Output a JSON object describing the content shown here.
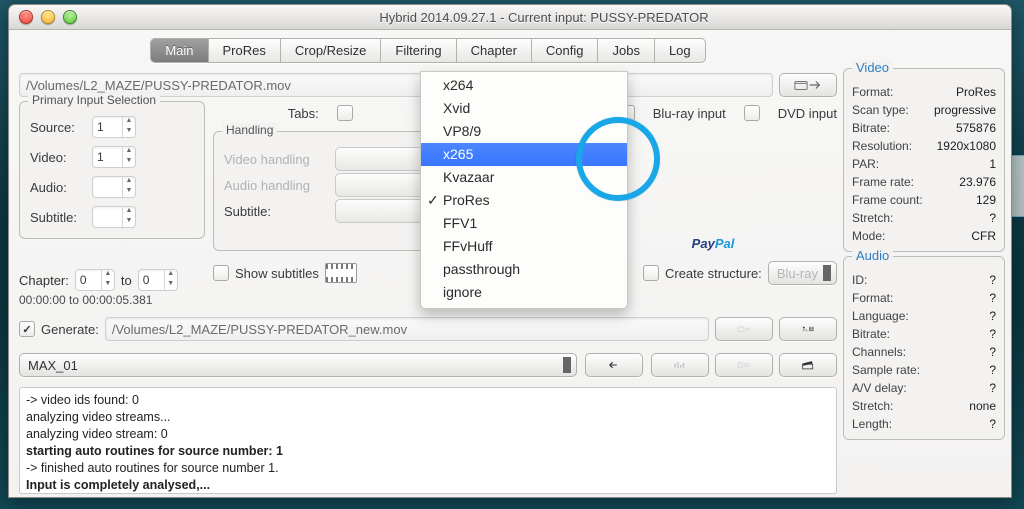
{
  "window_title": "Hybrid 2014.09.27.1 - Current input: PUSSY-PREDATOR",
  "tabs": [
    "Main",
    "ProRes",
    "Crop/Resize",
    "Filtering",
    "Chapter",
    "Config",
    "Jobs",
    "Log"
  ],
  "tabs_selected": 0,
  "source_path": "/Volumes/L2_MAZE/PUSSY-PREDATOR.mov",
  "primary": {
    "legend": "Primary Input Selection",
    "source_label": "Source:",
    "source_value": "1",
    "video_label": "Video:",
    "video_value": "1",
    "audio_label": "Audio:",
    "subtitle_label": "Subtitle:"
  },
  "tabs_line": {
    "tabs_label": "Tabs:",
    "bluray_label": "Blu-ray input",
    "dvd_label": "DVD input"
  },
  "paypal": {
    "pay": "Pay",
    "pal": "Pal"
  },
  "handling": {
    "legend": "Handling",
    "video_label": "Video handling",
    "audio_label": "Audio handling",
    "subtitle_label": "Subtitle:"
  },
  "codec_menu": {
    "items": [
      "x264",
      "Xvid",
      "VP8/9",
      "x265",
      "Kvazaar",
      "ProRes",
      "FFV1",
      "FFvHuff",
      "passthrough",
      "ignore"
    ],
    "highlighted": 3,
    "checked": 5
  },
  "chapter": {
    "label": "Chapter:",
    "to": "to",
    "from": "0",
    "to_val": "0",
    "timecode": "00:00:00 to 00:00:05.381"
  },
  "subs": {
    "show_label": "Show subtitles",
    "create_label": "Create structure:",
    "create_value": "Blu-ray"
  },
  "generate": {
    "cb_label": "Generate:",
    "path": "/Volumes/L2_MAZE/PUSSY-PREDATOR_new.mov"
  },
  "preset": "MAX_01",
  "log": [
    " -> video ids found: 0",
    "  analyzing video streams...",
    "  analyzing video stream: 0",
    "starting auto routines for source number: 1",
    " -> finished auto routines for source number 1.",
    "Input is completely analysed,..."
  ],
  "log_bold": [
    false,
    false,
    false,
    true,
    false,
    true
  ],
  "video_info": {
    "legend": "Video",
    "rows": [
      [
        "Format:",
        "ProRes"
      ],
      [
        "Scan type:",
        "progressive"
      ],
      [
        "Bitrate:",
        "575876"
      ],
      [
        "Resolution:",
        "1920x1080"
      ],
      [
        "PAR:",
        "1"
      ],
      [
        "Frame rate:",
        "23.976"
      ],
      [
        "Frame count:",
        "129"
      ],
      [
        "Stretch:",
        "?"
      ],
      [
        "Mode:",
        "CFR"
      ]
    ]
  },
  "audio_info": {
    "legend": "Audio",
    "rows": [
      [
        "ID:",
        "?"
      ],
      [
        "Format:",
        "?"
      ],
      [
        "Language:",
        "?"
      ],
      [
        "Bitrate:",
        "?"
      ],
      [
        "Channels:",
        "?"
      ],
      [
        "Sample rate:",
        "?"
      ],
      [
        "A/V delay:",
        "?"
      ],
      [
        "Stretch:",
        "none"
      ],
      [
        "Length:",
        "?"
      ]
    ]
  }
}
